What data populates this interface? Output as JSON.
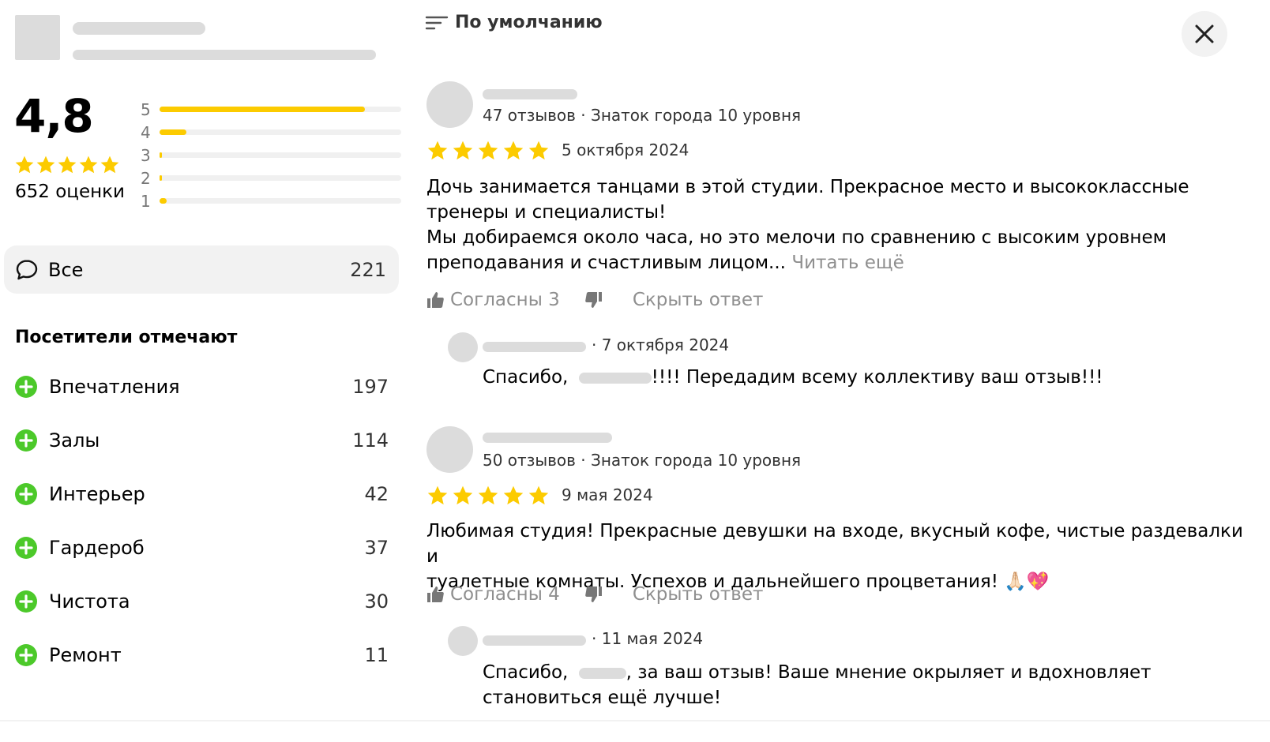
{
  "summary": {
    "rating": "4,8",
    "rating_count": "652 оценки",
    "distribution": [
      {
        "label": "5",
        "fraction": 0.85
      },
      {
        "label": "4",
        "fraction": 0.11
      },
      {
        "label": "3",
        "fraction": 0.01
      },
      {
        "label": "2",
        "fraction": 0.01
      },
      {
        "label": "1",
        "fraction": 0.03
      }
    ],
    "star_color": "#fccb00"
  },
  "filter_all": {
    "label": "Все",
    "count": "221"
  },
  "aspects": {
    "title": "Посетители отмечают",
    "items": [
      {
        "label": "Впечатления",
        "count": "197"
      },
      {
        "label": "Залы",
        "count": "114"
      },
      {
        "label": "Интерьер",
        "count": "42"
      },
      {
        "label": "Гардероб",
        "count": "37"
      },
      {
        "label": "Чистота",
        "count": "30"
      },
      {
        "label": "Ремонт",
        "count": "11"
      }
    ],
    "icon_color": "#4cc92a"
  },
  "sort": {
    "label": "По умолчанию"
  },
  "reviews": [
    {
      "meta": "47 отзывов · Знаток города 10 уровня",
      "stars": 5,
      "date": "5 октября 2024",
      "text_lines": [
        "Дочь занимается танцами в этой студии. Прекрасное место и высококлассные",
        "тренеры и специалисты!",
        "Мы добираемся около часа, но это мелочи по сравнению с высоким уровнем",
        "преподавания и счастливым лицом..."
      ],
      "read_more": "Читать ещё",
      "agree": "Согласны 3",
      "hide_reply": "Скрыть ответ",
      "reply": {
        "date": "· 7 октября 2024",
        "text_before": "Спасибо,",
        "text_after": "!!!! Передадим всему коллективу ваш отзыв!!!"
      }
    },
    {
      "meta": "50 отзывов · Знаток города 10 уровня",
      "stars": 5,
      "date": "9 мая 2024",
      "text_lines": [
        "Любимая студия! Прекрасные девушки на входе, вкусный кофе, чистые раздевалки и",
        "туалетные комнаты. Успехов и дальнейшего процветания! 🙏🏻💖"
      ],
      "agree": "Согласны 4",
      "hide_reply": "Скрыть ответ",
      "reply": {
        "date": "· 11 мая 2024",
        "text_before": "Спасибо,",
        "text_after": ", за ваш отзыв! Ваше мнение окрыляет и вдохновляет",
        "text_line2": "становиться ещё лучше!"
      }
    }
  ]
}
